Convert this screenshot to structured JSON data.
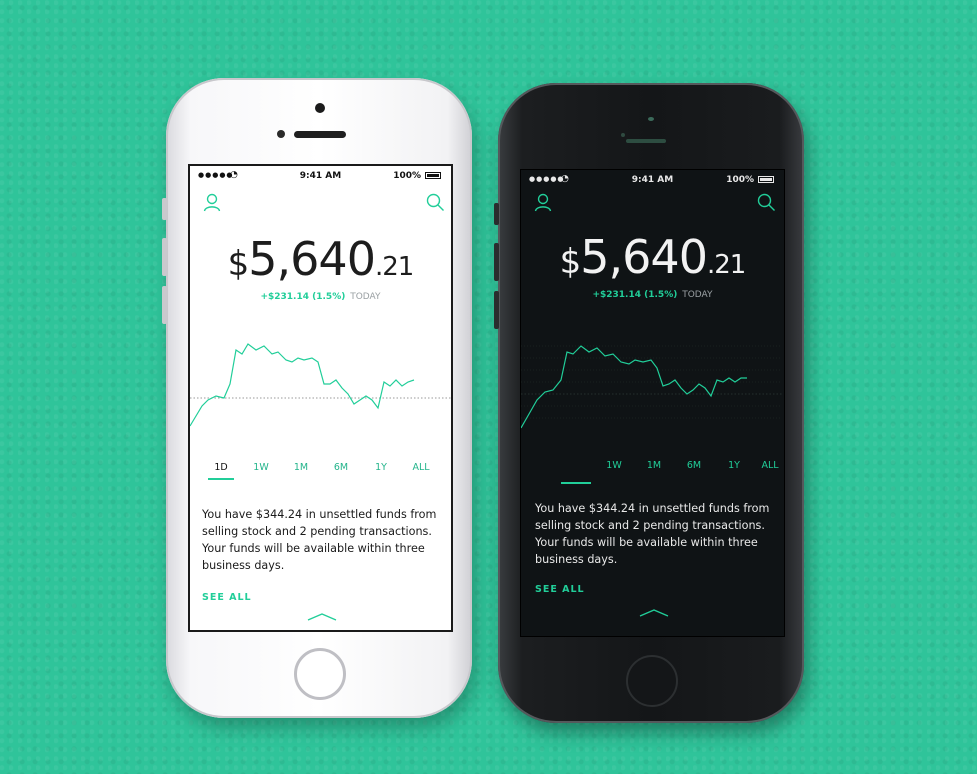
{
  "phones": [
    {
      "theme": "light",
      "status": {
        "time": "9:41 AM",
        "battery": "100%"
      },
      "balance": {
        "dollar": "$",
        "main": "5,640",
        "cents": ".21"
      },
      "change": {
        "delta": "+$231.14 (1.5%)",
        "period": "TODAY"
      },
      "ranges": [
        "1D",
        "1W",
        "1M",
        "6M",
        "1Y",
        "ALL"
      ],
      "active_range": "1D",
      "message": "You have $344.24 in unsettled funds from selling stock and 2 pending transactions. Your funds will be available within three business days.",
      "see_all": "SEE ALL"
    },
    {
      "theme": "dark",
      "status": {
        "time": "9:41 AM",
        "battery": "100%"
      },
      "balance": {
        "dollar": "$",
        "main": "5,640",
        "cents": ".21"
      },
      "change": {
        "delta": "+$231.14 (1.5%)",
        "period": "TODAY"
      },
      "ranges": [
        "1W",
        "1M",
        "6M",
        "1Y",
        "ALL"
      ],
      "active_range": "1D",
      "message": "You have $344.24 in unsettled funds from selling stock and 2 pending transactions. Your funds will be available within three business days.",
      "see_all": "SEE ALL"
    }
  ],
  "colors": {
    "accent": "#21ce99",
    "background": "#2fc49a",
    "dark_screen": "#0f1315"
  },
  "icons": {
    "profile": "user-icon",
    "search": "search-icon",
    "handle": "chevron-up-icon"
  }
}
